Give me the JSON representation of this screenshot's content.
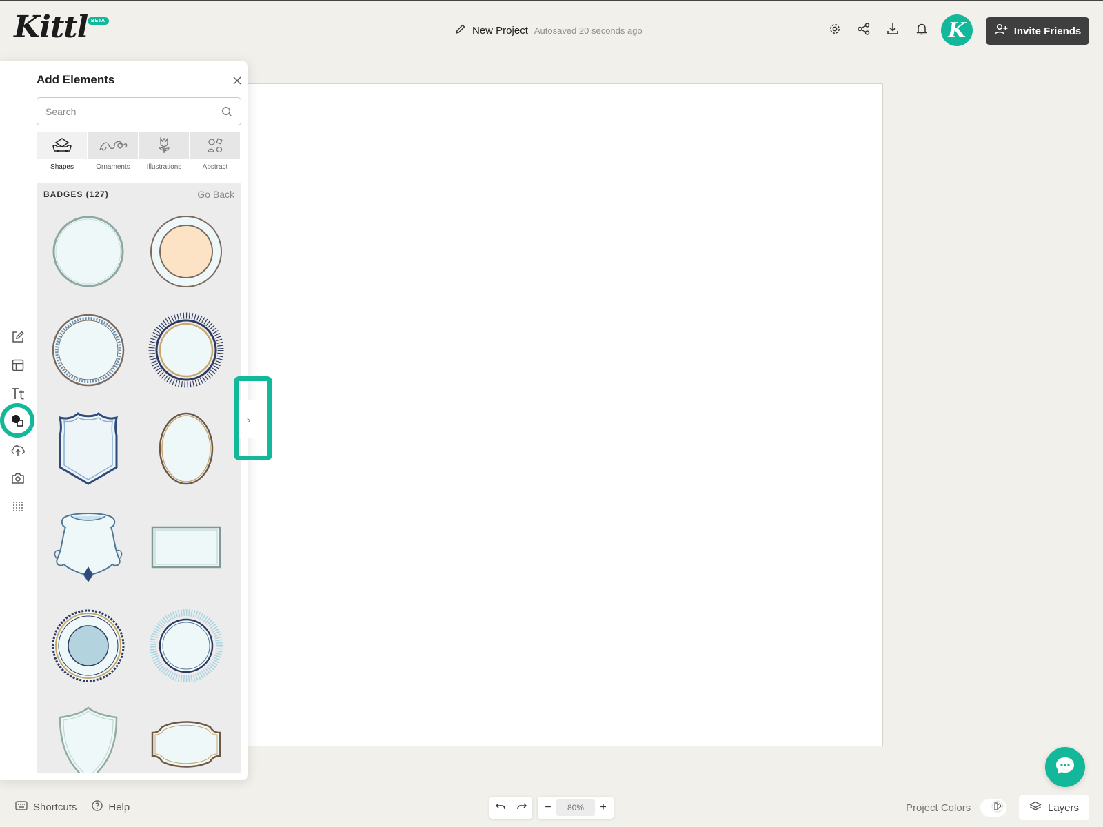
{
  "app": {
    "logo_text": "Kittl",
    "beta_label": "BETA",
    "brand_color": "#12b899"
  },
  "header": {
    "project_name": "New Project",
    "autosave_text": "Autosaved 20 seconds ago",
    "icons": [
      "gear-icon",
      "share-icon",
      "download-icon",
      "bell-icon"
    ],
    "avatar_letter": "K",
    "invite_label": "Invite Friends"
  },
  "rail": {
    "items": [
      "edit-icon",
      "templates-icon",
      "text-icon",
      "elements-icon",
      "upload-icon",
      "photos-icon",
      "patterns-icon"
    ],
    "active": "elements-icon"
  },
  "panel": {
    "title": "Add Elements",
    "search_placeholder": "Search",
    "tabs": [
      {
        "label": "Shapes",
        "icon": "shapes-icon",
        "active": true
      },
      {
        "label": "Ornaments",
        "icon": "ornaments-icon",
        "active": false
      },
      {
        "label": "Illustrations",
        "icon": "illustrations-icon",
        "active": false
      },
      {
        "label": "Abstract",
        "icon": "abstract-icon",
        "active": false
      }
    ],
    "section_title": "BADGES (127)",
    "go_back": "Go Back",
    "badges": [
      "plain-circle-badge",
      "peach-circle-badge",
      "rope-circle-badge",
      "sunburst-circle-badge",
      "shield-badge",
      "oval-badge",
      "ornate-crest-badge",
      "rectangle-badge",
      "scalloped-circle-badge",
      "rays-circle-badge",
      "pointed-shield-badge",
      "label-badge"
    ]
  },
  "footer": {
    "shortcuts": "Shortcuts",
    "help": "Help",
    "zoom_value": "80%",
    "project_colors": "Project Colors",
    "layers": "Layers"
  }
}
